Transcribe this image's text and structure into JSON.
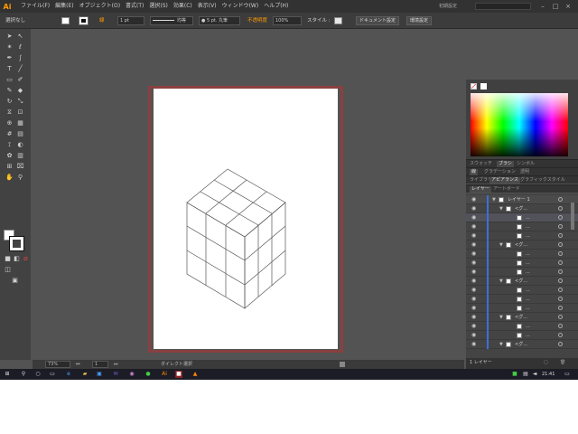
{
  "app": {
    "logo": "Ai"
  },
  "menu": [
    "ファイル(F)",
    "編集(E)",
    "オブジェクト(O)",
    "書式(T)",
    "選択(S)",
    "効果(C)",
    "表示(V)",
    "ウィンドウ(W)",
    "ヘルプ(H)"
  ],
  "header": {
    "workspace": "初期設定"
  },
  "controlbar": {
    "selection": "選択なし",
    "stroke_weight": "1 pt",
    "stroke_style": "均等",
    "brush": "5 pt. 丸筆",
    "opacity_label": "不透明度",
    "opacity_value": "100%",
    "style_label": "スタイル :",
    "doc_setup": "ドキュメント設定",
    "prefs": "環境設定"
  },
  "statusbar": {
    "zoom": "73%",
    "page": "1",
    "tool": "ダイレクト選択"
  },
  "panels": {
    "tabs_row1": [
      "スウォッチ",
      "ブラシ",
      "シンボル"
    ],
    "tabs_row2": [
      "線",
      "グラデーション",
      "透明"
    ],
    "tabs_row3": [
      "ライブラリ",
      "アピアランス",
      "グラフィックスタイル"
    ],
    "tabs_row4": [
      "レイヤー",
      "アートボード"
    ],
    "footer": "1 レイヤー"
  },
  "layers": {
    "top": "レイヤー 1",
    "group": "<グ...",
    "path": "..."
  },
  "taskbar": {
    "time": "21:41"
  },
  "colors": {
    "accent": "#ff9a00",
    "artboard_border": "#8a4040",
    "layer_bar": "#3d6fd8"
  }
}
